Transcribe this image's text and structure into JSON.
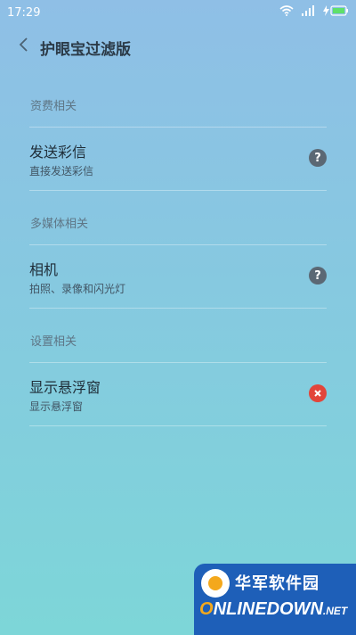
{
  "status_bar": {
    "time": "17:29",
    "icons": [
      "wifi-icon",
      "signal-icon",
      "battery-charging-icon"
    ]
  },
  "header": {
    "back_icon": "chevron-left-icon",
    "title": "护眼宝过滤版"
  },
  "sections": [
    {
      "header": "资费相关",
      "items": [
        {
          "title": "发送彩信",
          "subtitle": "直接发送彩信",
          "status_icon": "help-icon"
        }
      ]
    },
    {
      "header": "多媒体相关",
      "items": [
        {
          "title": "相机",
          "subtitle": "拍照、录像和闪光灯",
          "status_icon": "help-icon"
        }
      ]
    },
    {
      "header": "设置相关",
      "items": [
        {
          "title": "显示悬浮窗",
          "subtitle": "显示悬浮窗",
          "status_icon": "deny-icon"
        }
      ]
    }
  ],
  "watermark": {
    "cn": "华军软件园",
    "en": "NLINEDOWN",
    "en_suffix": ".NET"
  },
  "colors": {
    "help_icon": "#5b6874",
    "deny_icon": "#e2453a",
    "watermark_bg": "#1e5fb8"
  }
}
